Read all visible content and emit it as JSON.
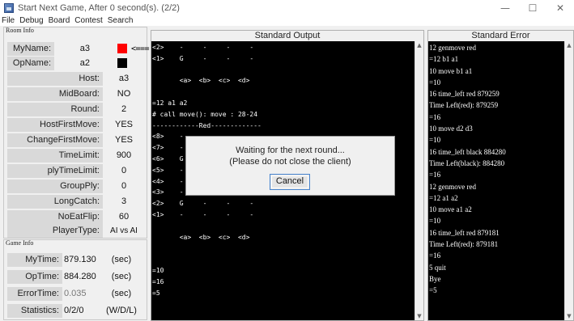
{
  "window": {
    "title": "Start Next Game, After 0 second(s). (2/2)",
    "controls": [
      "—",
      "☐",
      "✕"
    ]
  },
  "menu": [
    "File",
    "Debug",
    "Board",
    "Contest",
    "Search"
  ],
  "room_info": {
    "title": "Room Info",
    "my_name": {
      "label": "MyName:",
      "value": "a3",
      "color": "#ff0000",
      "arrow": "<==="
    },
    "op_name": {
      "label": "OpName:",
      "value": "a2",
      "color": "#000000"
    },
    "fields": [
      {
        "label": "Host:",
        "value": "a3"
      },
      {
        "label": "MidBoard:",
        "value": "NO"
      },
      {
        "label": "Round:",
        "value": "2"
      },
      {
        "label": "HostFirstMove:",
        "value": "YES"
      },
      {
        "label": "ChangeFirstMove:",
        "value": "YES"
      },
      {
        "label": "TimeLimit:",
        "value": "900"
      },
      {
        "label": "plyTimeLimit:",
        "value": "0"
      },
      {
        "label": "GroupPly:",
        "value": "0"
      },
      {
        "label": "LongCatch:",
        "value": "3"
      },
      {
        "label": "NoEatFlip:",
        "value": "60"
      },
      {
        "label": "PlayerType:",
        "value": "AI vs AI"
      }
    ]
  },
  "game_info": {
    "title": "Game Info",
    "rows": [
      {
        "label": "MyTime:",
        "value": "879.130",
        "unit": "(sec)"
      },
      {
        "label": "OpTime:",
        "value": "884.280",
        "unit": "(sec)"
      },
      {
        "label": "ErrorTime:",
        "value": "0.035",
        "unit": "(sec)"
      },
      {
        "label": "Statistics:",
        "value": "0/2/0",
        "unit": "(W/D/L)"
      }
    ]
  },
  "stdout": {
    "title": "Standard Output",
    "lines": [
      "<2>    -     -     -     -",
      "<1>    G     -     -     -",
      "",
      "       <a>  <b>  <c>  <d>",
      "",
      "=12 a1 a2",
      "# call move(): move : 28-24",
      "------------Red-------------",
      "<8>    -",
      "<7>    -",
      "<6>    G",
      "<5>    -",
      "<4>    -     g     -     -",
      "<3>    -     -     -     m",
      "<2>    G     -     -     -",
      "<1>    -     -     -     -",
      "",
      "       <a>  <b>  <c>  <d>",
      "",
      "",
      "=10",
      "=16",
      "=5"
    ]
  },
  "stderr": {
    "title": "Standard Error",
    "lines": [
      "12 genmove red",
      "=12 b1 a1",
      "10 move b1 a1",
      "=10",
      "16 time_left red 879259",
      "Time Left(red): 879259",
      "=16",
      "10 move d2 d3",
      "=10",
      "16 time_left black 884280",
      "Time Left(black): 884280",
      "=16",
      "12 genmove red",
      "=12 a1 a2",
      "10 move a1 a2",
      "=10",
      "16 time_left red 879181",
      "Time Left(red): 879181",
      "=16",
      "5 quit",
      "Bye",
      "=5"
    ]
  },
  "dialog": {
    "line1": "Waiting for the next round...",
    "line2": "(Please do not close the client)",
    "button": "Cancel"
  }
}
